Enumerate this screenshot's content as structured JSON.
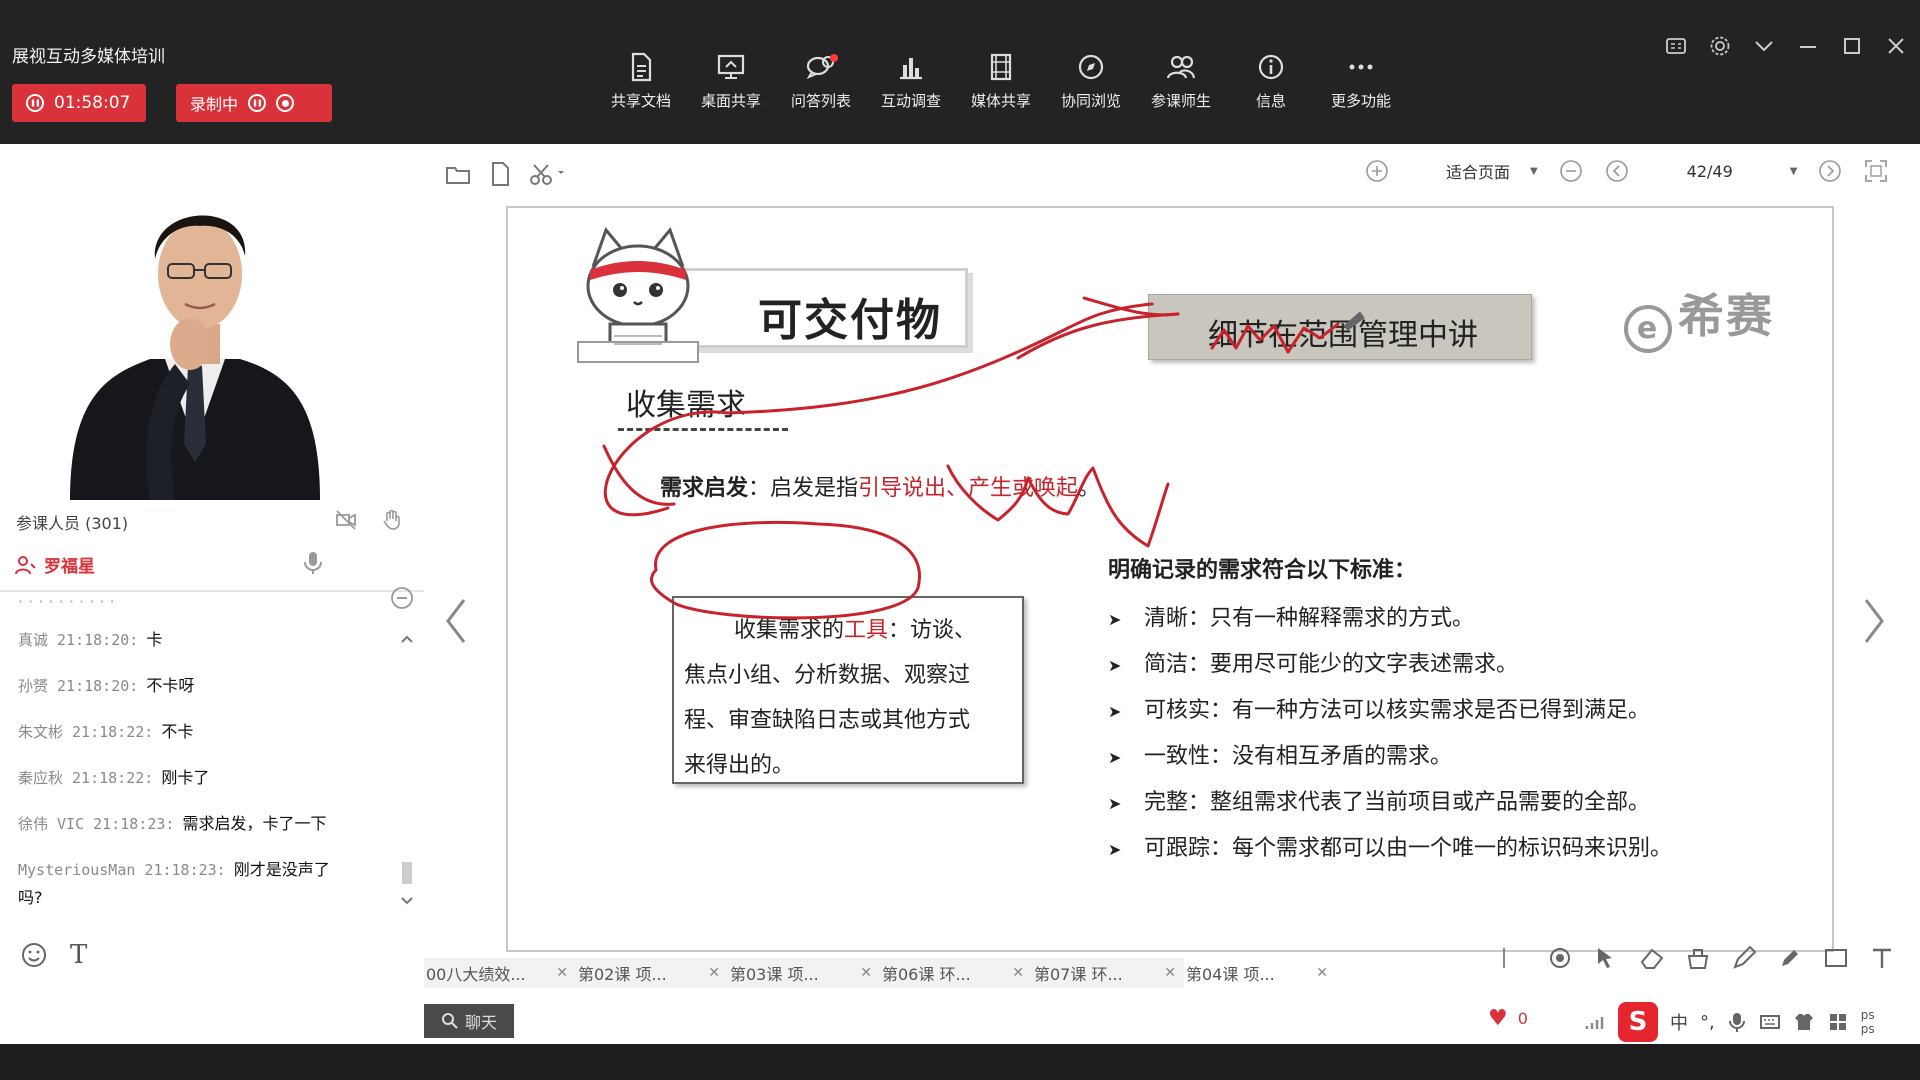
{
  "app": {
    "title": "展视互动多媒体培训",
    "timer": "01:58:07",
    "recording_label": "录制中"
  },
  "toolbar": {
    "items": [
      {
        "label": "共享文档",
        "icon": "document-icon"
      },
      {
        "label": "桌面共享",
        "icon": "desktop-share-icon"
      },
      {
        "label": "问答列表",
        "icon": "qa-icon"
      },
      {
        "label": "互动调查",
        "icon": "survey-chart-icon"
      },
      {
        "label": "媒体共享",
        "icon": "film-icon"
      },
      {
        "label": "协同浏览",
        "icon": "compass-icon"
      },
      {
        "label": "参课师生",
        "icon": "people-icon"
      },
      {
        "label": "信息",
        "icon": "info-icon"
      },
      {
        "label": "更多功能",
        "icon": "more-icon"
      }
    ]
  },
  "left": {
    "participants": "参课人员 (301)",
    "teacher": "罗福星"
  },
  "chat": {
    "messages": [
      {
        "who": "真诚 21:18:20:",
        "text": "卡"
      },
      {
        "who": "孙赟 21:18:20:",
        "text": "不卡呀"
      },
      {
        "who": "朱文彬 21:18:22:",
        "text": "不卡"
      },
      {
        "who": "秦应秋 21:18:22:",
        "text": "刚卡了"
      },
      {
        "who": "徐伟 VIC 21:18:23:",
        "text": "需求启发，卡了一下"
      },
      {
        "who": "MysteriousMan 21:18:23:",
        "text": "刚才是没声了"
      }
    ],
    "last_message_tail": "吗?",
    "input_text_icon": "T"
  },
  "doc_toolbar": {
    "fit_label": "适合页面",
    "page": "42/49"
  },
  "slide": {
    "title": "可交付物",
    "brand": "希赛",
    "brand_mark": "e",
    "callout": "细节在范围管理中讲",
    "subhead": "收集需求",
    "inspire_label": "需求启发",
    "inspire_mid": "：启发是指",
    "inspire_red": "引导说出、产生或唤起",
    "inspire_end": "。",
    "tools_lead": "收集需求的",
    "tools_red": "工具",
    "tools_line1_rest": "：访谈、",
    "tools_line2": "焦点小组、分析数据、观察过",
    "tools_line3": "程、审查缺陷日志或其他方式",
    "tools_line4": "来得出的。",
    "criteria_title": "明确记录的需求符合以下标准：",
    "criteria": [
      "清晰：只有一种解释需求的方式。",
      "简洁：要用尽可能少的文字表述需求。",
      "可核实：有一种方法可以核实需求是否已得到满足。",
      "一致性：没有相互矛盾的需求。",
      "完整：整组需求代表了当前项目或产品需要的全部。",
      "可跟踪：每个需求都可以由一个唯一的标识码来识别。"
    ]
  },
  "tabs": [
    {
      "label": "00八大绩效..."
    },
    {
      "label": "第02课 项..."
    },
    {
      "label": "第03课 项..."
    },
    {
      "label": "第06课 环..."
    },
    {
      "label": "第07课 环..."
    },
    {
      "label": "第04课 项..."
    }
  ],
  "bottom": {
    "chat_button": "聊天",
    "likes": "0",
    "ime_lang": "中",
    "net_speed_1": "ps",
    "net_speed_2": "ps"
  },
  "colors": {
    "accent_red": "#d9323a",
    "annotation_red": "#c8232c",
    "topbar": "#232323"
  }
}
